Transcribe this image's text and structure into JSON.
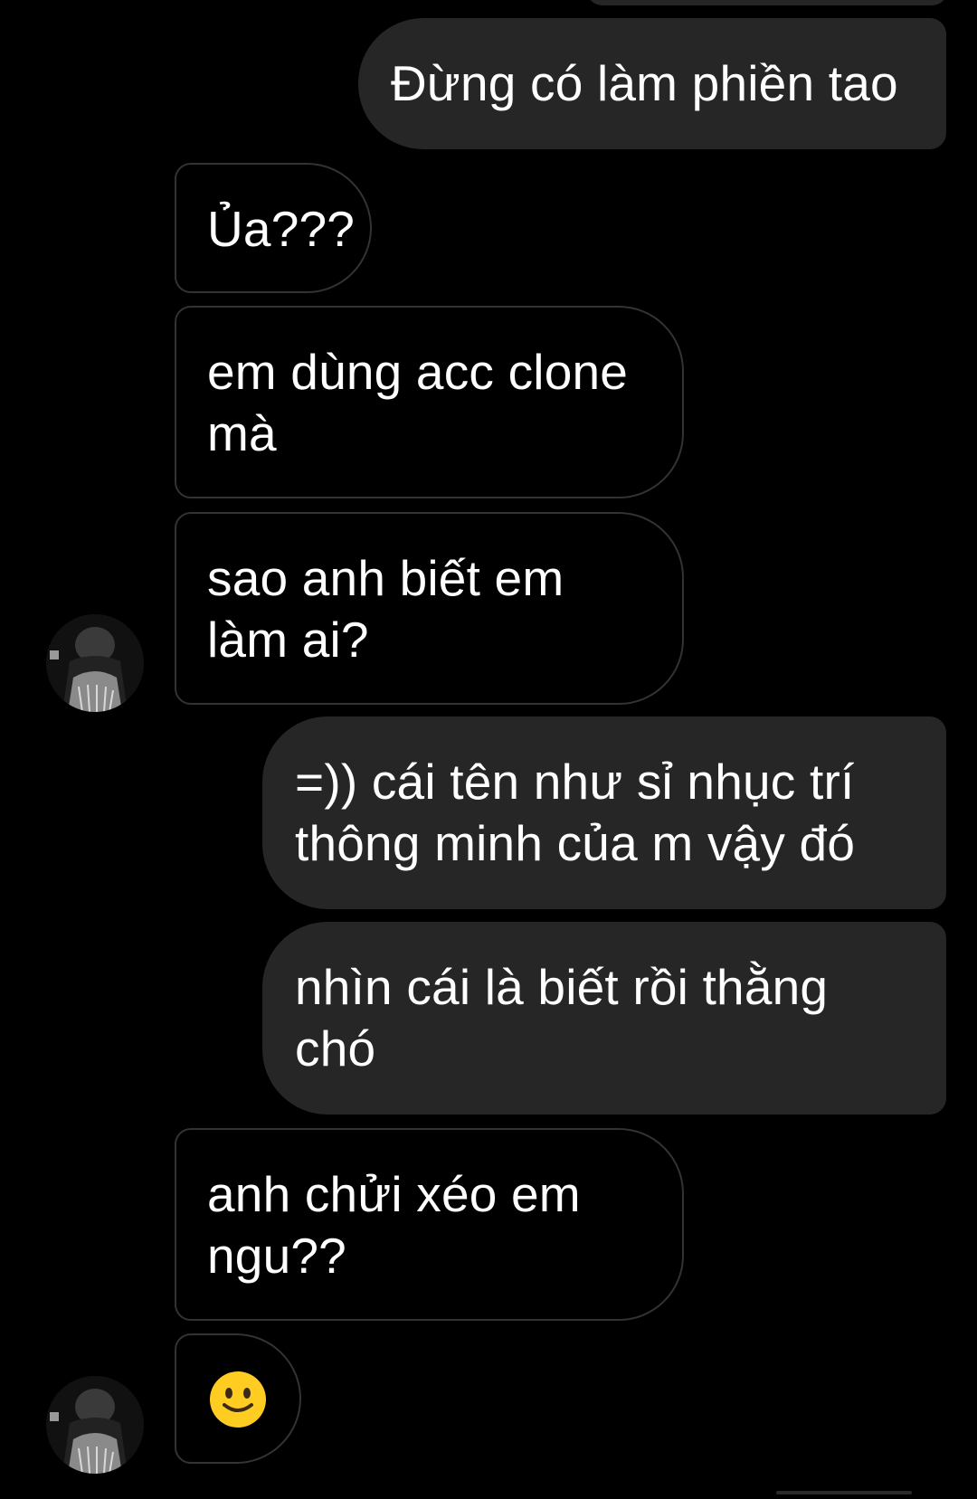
{
  "conversation": {
    "messages": [
      {
        "side": "out",
        "text": "Đừng có làm phiền tao"
      },
      {
        "side": "in",
        "text": "Ủa???"
      },
      {
        "side": "in",
        "lines": [
          "em dùng acc clone",
          "mà"
        ]
      },
      {
        "side": "in",
        "lines": [
          "sao anh biết em",
          "làm ai?"
        ]
      },
      {
        "side": "out",
        "lines": [
          "=)) cái tên như sỉ nhục trí",
          "thông minh của m vậy đó"
        ]
      },
      {
        "side": "out",
        "lines": [
          "nhìn cái là biết rồi thằng",
          "chó"
        ]
      },
      {
        "side": "in",
        "lines": [
          "anh chửi xéo em",
          "ngu??"
        ]
      },
      {
        "side": "in",
        "emoji": "slightly-smiling-face"
      }
    ]
  },
  "colors": {
    "background": "#000000",
    "outgoing_bubble": "#262626",
    "incoming_border": "#333333",
    "text": "#ffffff",
    "emoji_face": "#FFCC22"
  },
  "icons": {
    "avatar": "contact-avatar-photo",
    "emoji": "slightly-smiling-face-emoji"
  }
}
